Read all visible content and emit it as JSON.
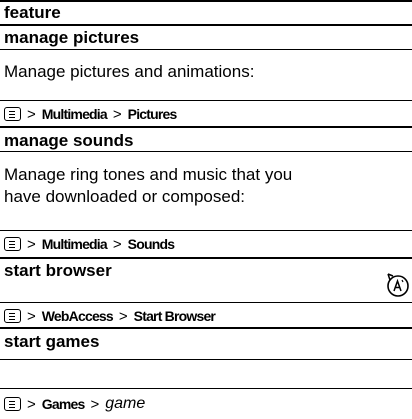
{
  "header": "feature",
  "rows": [
    {
      "title": "manage pictures",
      "desc": "Manage pictures and animations:",
      "path": [
        "Multimedia",
        "Pictures"
      ]
    },
    {
      "title": "manage sounds",
      "desc_line1": "Manage ring tones and music that you",
      "desc_line2": "have downloaded or composed:",
      "path": [
        "Multimedia",
        "Sounds"
      ]
    },
    {
      "title": "start browser",
      "path": [
        "WebAccess",
        "Start Browser"
      ],
      "icon": "network-feature-icon"
    },
    {
      "title": "start games",
      "path": [
        "Games"
      ],
      "path_italic": "game"
    }
  ],
  "separator": ">",
  "menu_key_icon": "menu-key-icon"
}
